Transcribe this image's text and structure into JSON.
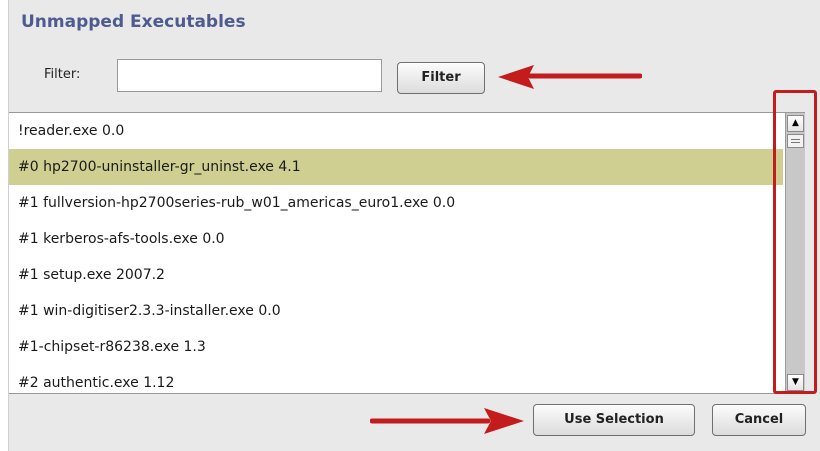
{
  "dialog": {
    "title": "Unmapped Executables"
  },
  "filter": {
    "label": "Filter:",
    "value": "",
    "placeholder": "",
    "button_label": "Filter"
  },
  "list": {
    "selected_index": 1,
    "items": [
      "!reader.exe 0.0",
      "#0 hp2700-uninstaller-gr_uninst.exe 4.1",
      "#1 fullversion-hp2700series-rub_w01_americas_euro1.exe 0.0",
      "#1 kerberos-afs-tools.exe 0.0",
      "#1 setup.exe 2007.2",
      "#1 win-digitiser2.3.3-installer.exe 0.0",
      "#1-chipset-r86238.exe 1.3",
      "#2 authentic.exe 1.12"
    ]
  },
  "footer": {
    "use_selection_label": "Use Selection",
    "cancel_label": "Cancel"
  },
  "colors": {
    "title": "#4e5b8e",
    "selected_row": "#cfcf92",
    "annotation": "#c41c1c"
  },
  "icons": {
    "scroll_up": "scroll-up-arrow-icon",
    "scroll_down": "scroll-down-arrow-icon",
    "annotation_arrow": "red-arrow-icon"
  }
}
